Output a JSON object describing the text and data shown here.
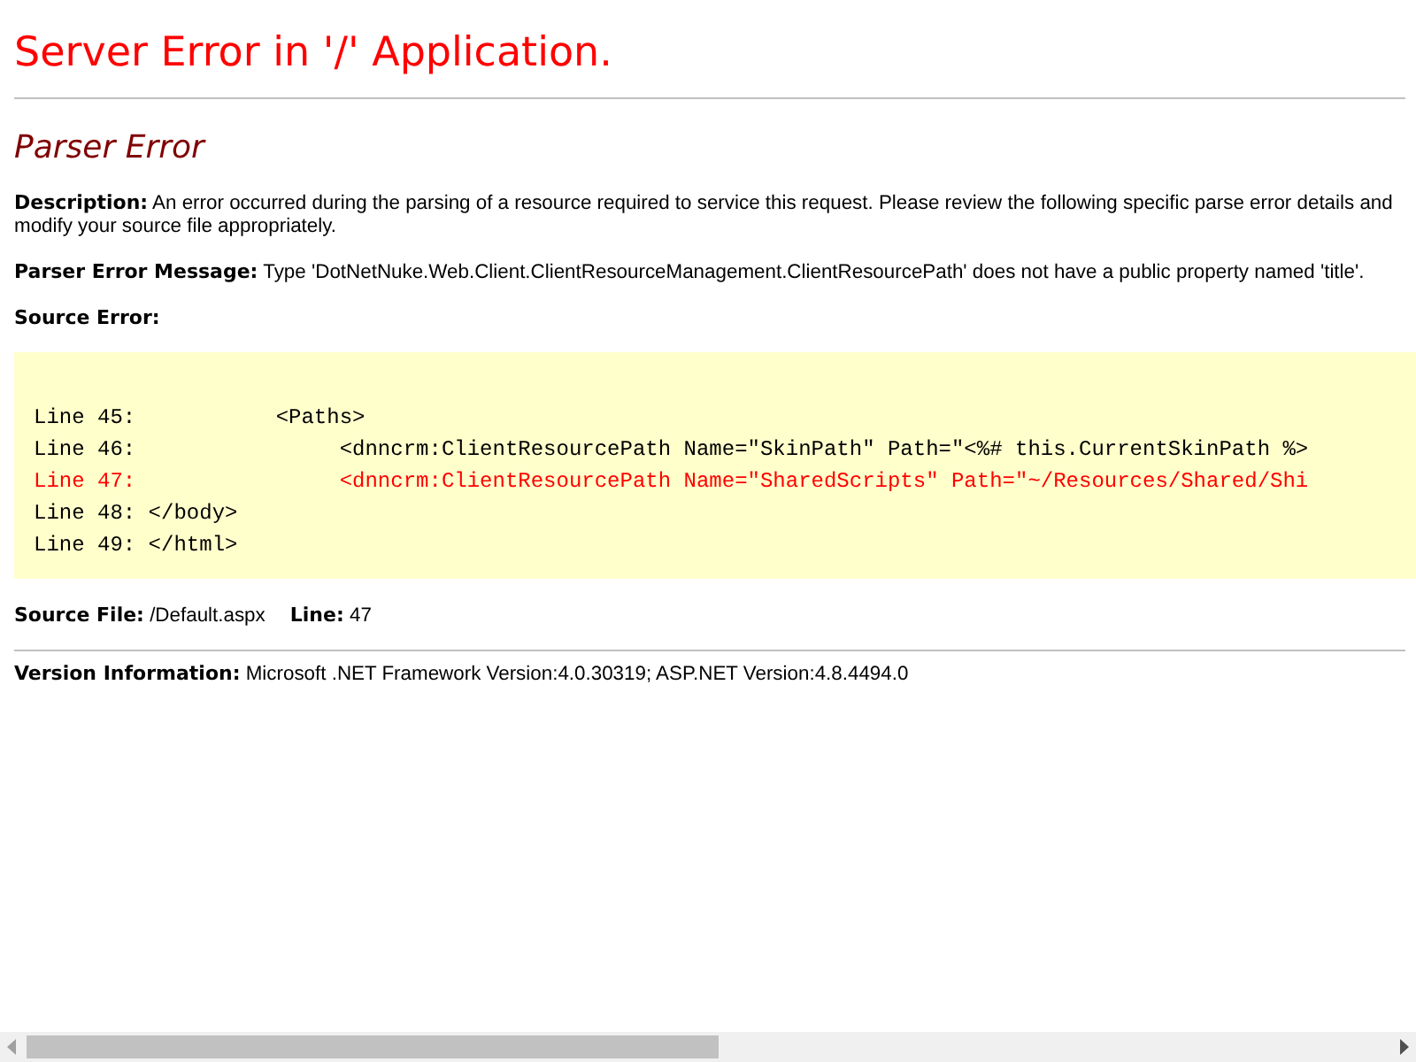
{
  "title": "Server Error in '/' Application.",
  "heading": "Parser Error",
  "description": {
    "label": "Description:",
    "text": "An error occurred during the parsing of a resource required to service this request. Please review the following specific parse error details and modify your source file appropriately."
  },
  "parser_error_message": {
    "label": "Parser Error Message:",
    "text": "Type 'DotNetNuke.Web.Client.ClientResourceManagement.ClientResourcePath' does not have a public property named 'title'."
  },
  "source_error": {
    "label": "Source Error:",
    "lines": [
      {
        "text": "Line 45:           <Paths>",
        "highlighted": false
      },
      {
        "text": "Line 46:                <dnncrm:ClientResourcePath Name=\"SkinPath\" Path=\"<%# this.CurrentSkinPath %>",
        "highlighted": false
      },
      {
        "text": "Line 47:                <dnncrm:ClientResourcePath Name=\"SharedScripts\" Path=\"~/Resources/Shared/Shi",
        "highlighted": true
      },
      {
        "text": "Line 48: </body>",
        "highlighted": false
      },
      {
        "text": "Line 49: </html>",
        "highlighted": false
      }
    ]
  },
  "source_file": {
    "label": "Source File:",
    "value": "/Default.aspx",
    "line_label": "Line:",
    "line_value": "47"
  },
  "version_information": {
    "label": "Version Information:",
    "text": "Microsoft .NET Framework Version:4.0.30319; ASP.NET Version:4.8.4494.0"
  }
}
